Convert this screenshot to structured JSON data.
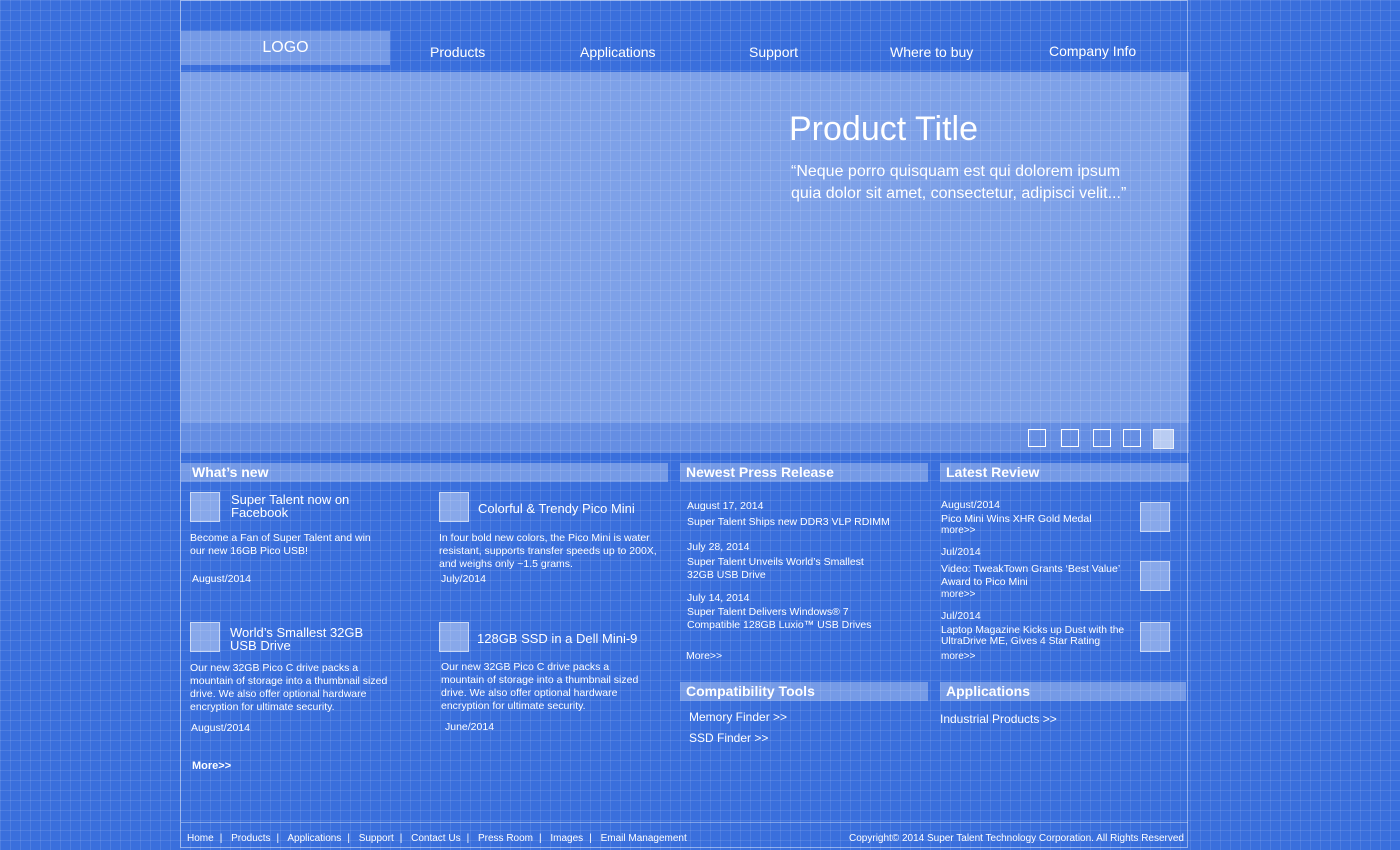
{
  "header": {
    "logo": "LOGO",
    "nav": [
      "Products",
      "Applications",
      "Support",
      "Where to buy",
      "Company Info"
    ]
  },
  "hero": {
    "title": "Product Title",
    "quote": "“Neque porro quisquam est qui dolorem ipsum quia dolor sit amet, consectetur, adipisci velit...”",
    "slides": 5,
    "active_slide": 5
  },
  "whats_new": {
    "heading": "What’s new",
    "items": [
      {
        "title": "Super Talent now on Facebook",
        "body": "Become a Fan of Super Talent and win our new 16GB Pico USB!",
        "date": "August/2014"
      },
      {
        "title": "Colorful & Trendy Pico Mini",
        "body": "In four bold new colors, the Pico Mini is water resistant, supports transfer speeds up to 200X, and weighs only ~1.5 grams.",
        "date": "July/2014"
      },
      {
        "title": "World’s Smallest 32GB USB Drive",
        "body": "Our new 32GB Pico C drive packs a mountain of storage into a thumbnail sized drive. We also offer optional hardware encryption for ultimate security.",
        "date": "August/2014"
      },
      {
        "title": "128GB SSD in a Dell Mini-9",
        "body": "Our new 32GB Pico C drive packs a mountain of storage into a thumbnail sized drive. We also offer optional hardware encryption for ultimate security.",
        "date": "June/2014"
      }
    ],
    "more": "More>>"
  },
  "press": {
    "heading": "Newest Press Release",
    "items": [
      {
        "date": "August 17, 2014",
        "title": "Super Talent Ships new DDR3 VLP RDIMM"
      },
      {
        "date": "July 28, 2014",
        "title": "Super Talent Unveils World’s Smallest 32GB USB Drive"
      },
      {
        "date": "July 14, 2014",
        "title": "Super Talent Delivers Windows® 7 Compatible 128GB Luxio™ USB Drives"
      }
    ],
    "more": "More>>"
  },
  "review": {
    "heading": "Latest Review",
    "items": [
      {
        "date": "August/2014",
        "title": "Pico Mini Wins XHR Gold Medal",
        "more": "more>>"
      },
      {
        "date": "Jul/2014",
        "title": "Video: TweakTown Grants ‘Best Value’ Award to Pico Mini",
        "more": "more>>"
      },
      {
        "date": "Jul/2014",
        "title": "Laptop Magazine Kicks up Dust with the UltraDrive ME, Gives 4 Star Rating",
        "more": "more>>"
      }
    ]
  },
  "tools": {
    "heading": "Compatibility Tools",
    "links": [
      "Memory Finder  >>",
      "SSD Finder >>"
    ]
  },
  "applications": {
    "heading": "Applications",
    "links": [
      "Industrial Products >>"
    ]
  },
  "footer": {
    "links": [
      "Home",
      "Products",
      "Applications",
      "Support",
      "Contact Us",
      "Press Room",
      "Images",
      "Email Management"
    ],
    "copyright": "Copyright© 2014 Super Talent Technology Corporation. All Rights Reserved"
  }
}
